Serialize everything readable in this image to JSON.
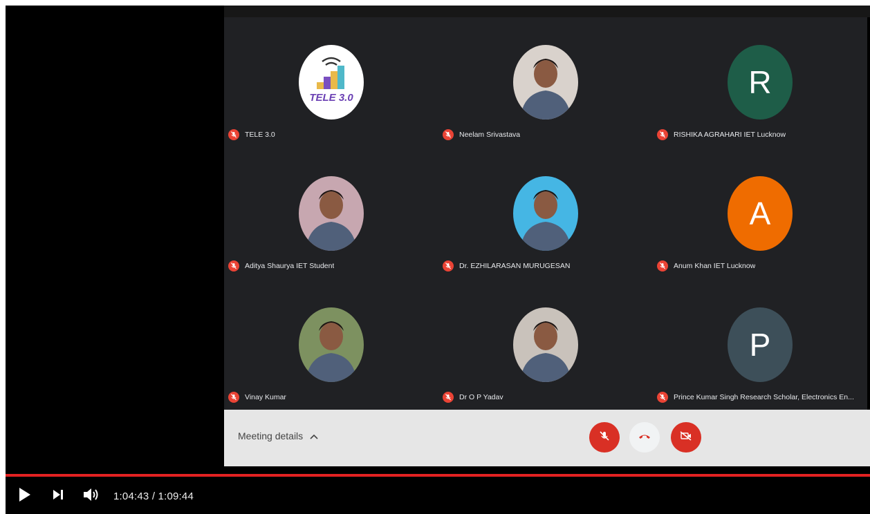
{
  "participants": [
    {
      "name": "TELE 3.0",
      "avatar_type": "logo",
      "logo_text": "TELE 3.0",
      "bg": "#ffffff"
    },
    {
      "name": "Neelam Srivastava",
      "avatar_type": "photo",
      "bg": "#d9d2cc"
    },
    {
      "name": "RISHIKA AGRAHARI IET Lucknow",
      "avatar_type": "letter",
      "initial": "R",
      "bg": "#1e5d48"
    },
    {
      "name": "Aditya Shaurya IET Student",
      "avatar_type": "photo",
      "bg": "#c7a7b0"
    },
    {
      "name": "Dr. EZHILARASAN MURUGESAN",
      "avatar_type": "photo",
      "bg": "#45b6e4"
    },
    {
      "name": "Anum Khan IET Lucknow",
      "avatar_type": "letter",
      "initial": "A",
      "bg": "#ef6c00"
    },
    {
      "name": "Vinay Kumar",
      "avatar_type": "photo",
      "bg": "#7d9160"
    },
    {
      "name": "Dr O P Yadav",
      "avatar_type": "photo",
      "bg": "#c9c2bb"
    },
    {
      "name": "Prince Kumar Singh Research Scholar, Electronics En...",
      "avatar_type": "letter",
      "initial": "P",
      "bg": "#3d4f59"
    }
  ],
  "meet_controls": {
    "meeting_details_label": "Meeting details",
    "mic_icon": "mic-off-icon",
    "hangup_icon": "hang-up-icon",
    "camera_icon": "camera-off-icon",
    "accent_red": "#ea4335"
  },
  "player": {
    "time_display": "1:04:43 / 1:09:44",
    "progress_fraction": 1.0,
    "progress_color": "#e32222",
    "play_icon": "play-icon",
    "next_icon": "next-icon",
    "volume_icon": "volume-icon"
  }
}
